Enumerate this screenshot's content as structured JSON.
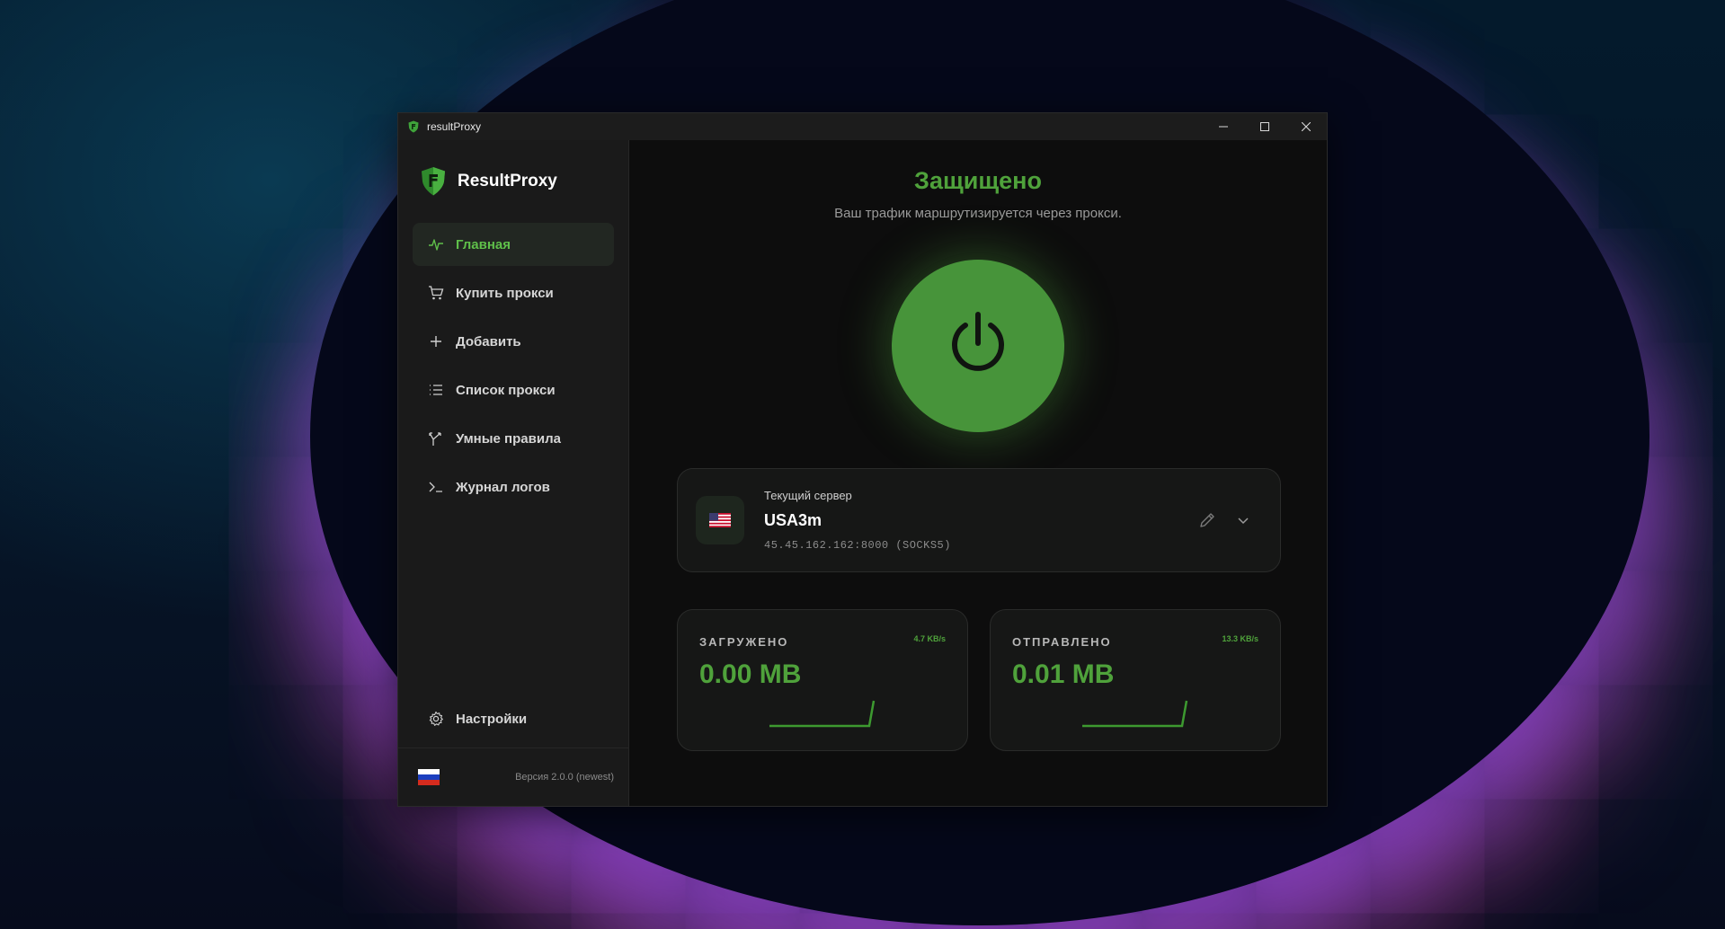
{
  "window": {
    "title": "resultProxy",
    "controls": {
      "minimize": "—",
      "maximize": "☐",
      "close": "✕"
    }
  },
  "brand": {
    "name": "ResultProxy"
  },
  "sidebar": {
    "items": [
      {
        "label": "Главная",
        "icon": "activity-icon",
        "active": true
      },
      {
        "label": "Купить прокси",
        "icon": "cart-icon",
        "active": false
      },
      {
        "label": "Добавить",
        "icon": "plus-icon",
        "active": false
      },
      {
        "label": "Список прокси",
        "icon": "list-icon",
        "active": false
      },
      {
        "label": "Умные правила",
        "icon": "branch-icon",
        "active": false
      },
      {
        "label": "Журнал логов",
        "icon": "terminal-icon",
        "active": false
      }
    ],
    "settings": {
      "label": "Настройки",
      "icon": "gear-icon"
    },
    "footer": {
      "language_flag": "ru-flag-icon",
      "version": "Версия 2.0.0 (newest)"
    }
  },
  "main": {
    "status_title": "Защищено",
    "status_subtitle": "Ваш трафик маршрутизируется через прокси.",
    "power_button": {
      "icon": "power-icon",
      "state": "on"
    },
    "server": {
      "label": "Текущий сервер",
      "name": "USA3m",
      "address": "45.45.162.162:8000 (SOCKS5)",
      "flag_icon": "us-flag-icon"
    },
    "stats": {
      "downloaded": {
        "label": "ЗАГРУЖЕНО",
        "value": "0.00 MB",
        "rate": "4.7 KB/s"
      },
      "uploaded": {
        "label": "ОТПРАВЛЕНО",
        "value": "0.01 MB",
        "rate": "13.3 KB/s"
      }
    }
  },
  "colors": {
    "accent": "#4fa23b",
    "power_button": "#47943a",
    "active_nav_bg": "#222722"
  }
}
